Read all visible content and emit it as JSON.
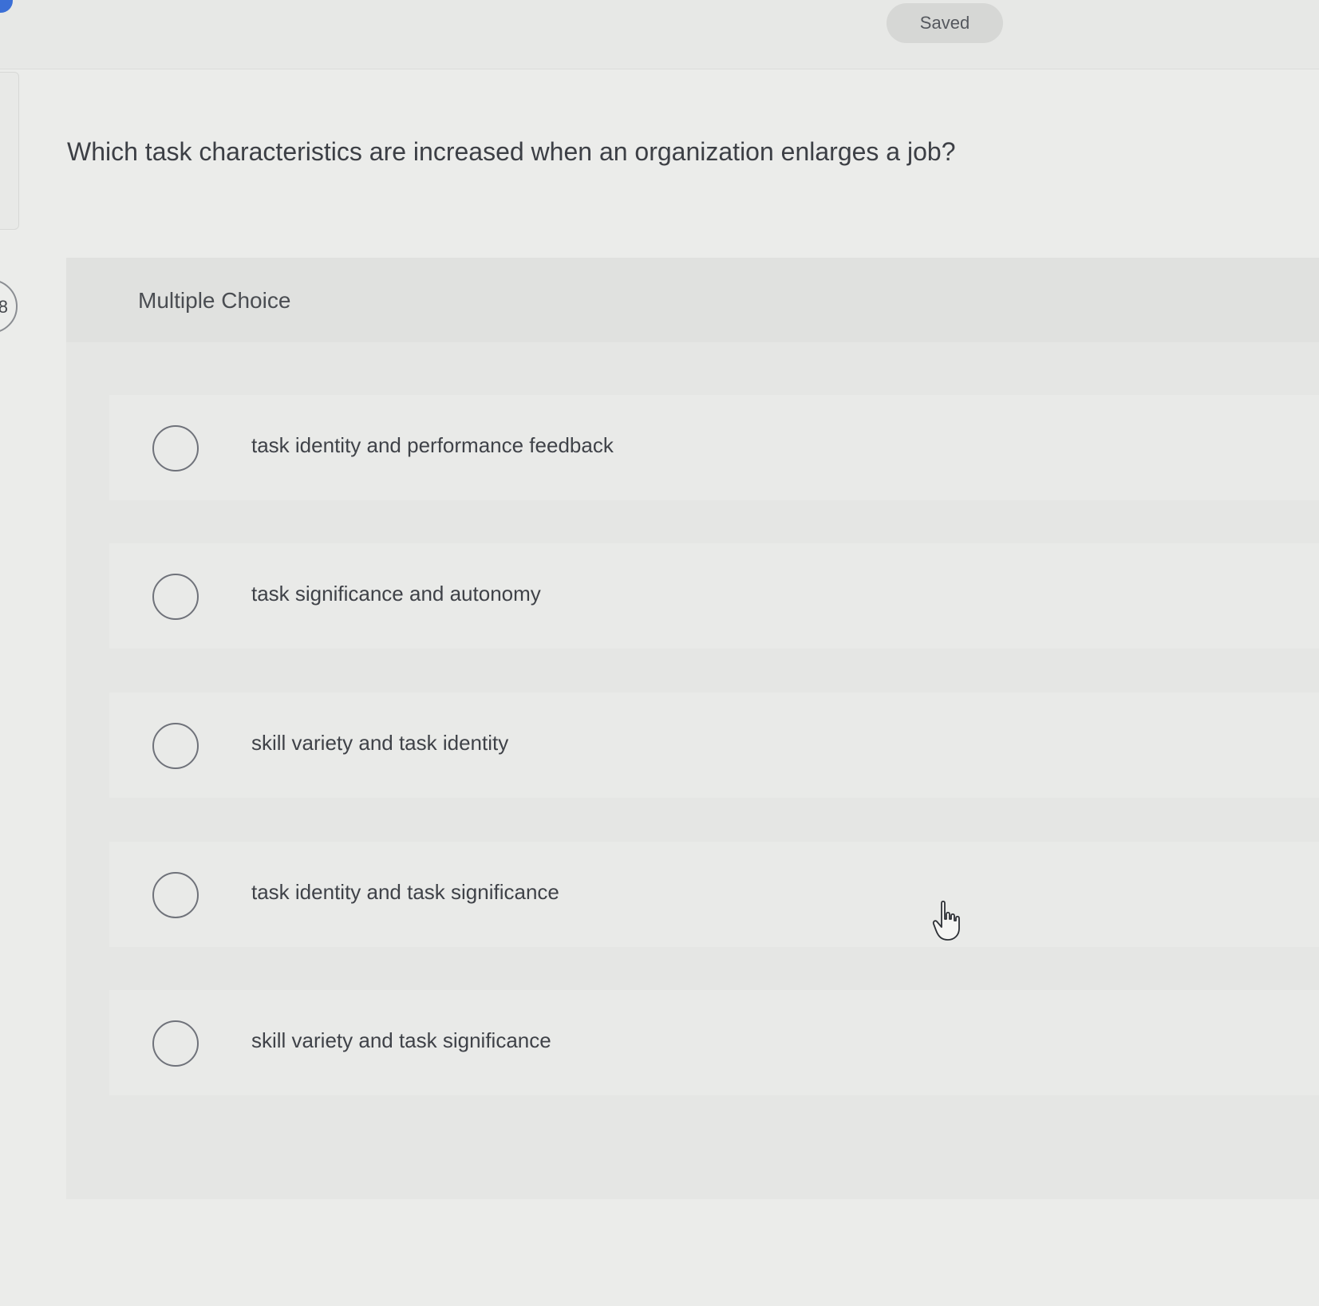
{
  "header": {
    "status": "Saved"
  },
  "question": {
    "number_visible": "8",
    "text": "Which task characteristics are increased when an organization enlarges a job?"
  },
  "answer_panel": {
    "label": "Multiple Choice",
    "options": [
      {
        "label": "task identity and performance feedback",
        "selected": false
      },
      {
        "label": "task significance and autonomy",
        "selected": false
      },
      {
        "label": "skill variety and task identity",
        "selected": false
      },
      {
        "label": "task identity and task significance",
        "selected": false
      },
      {
        "label": "skill variety and task significance",
        "selected": false
      }
    ]
  },
  "icons": {
    "cursor": "hand-pointer-icon",
    "radio": "radio-unchecked-icon"
  },
  "colors": {
    "accent": "#3b6fd6",
    "background": "#ebecea",
    "radio_border": "#6f727a"
  }
}
